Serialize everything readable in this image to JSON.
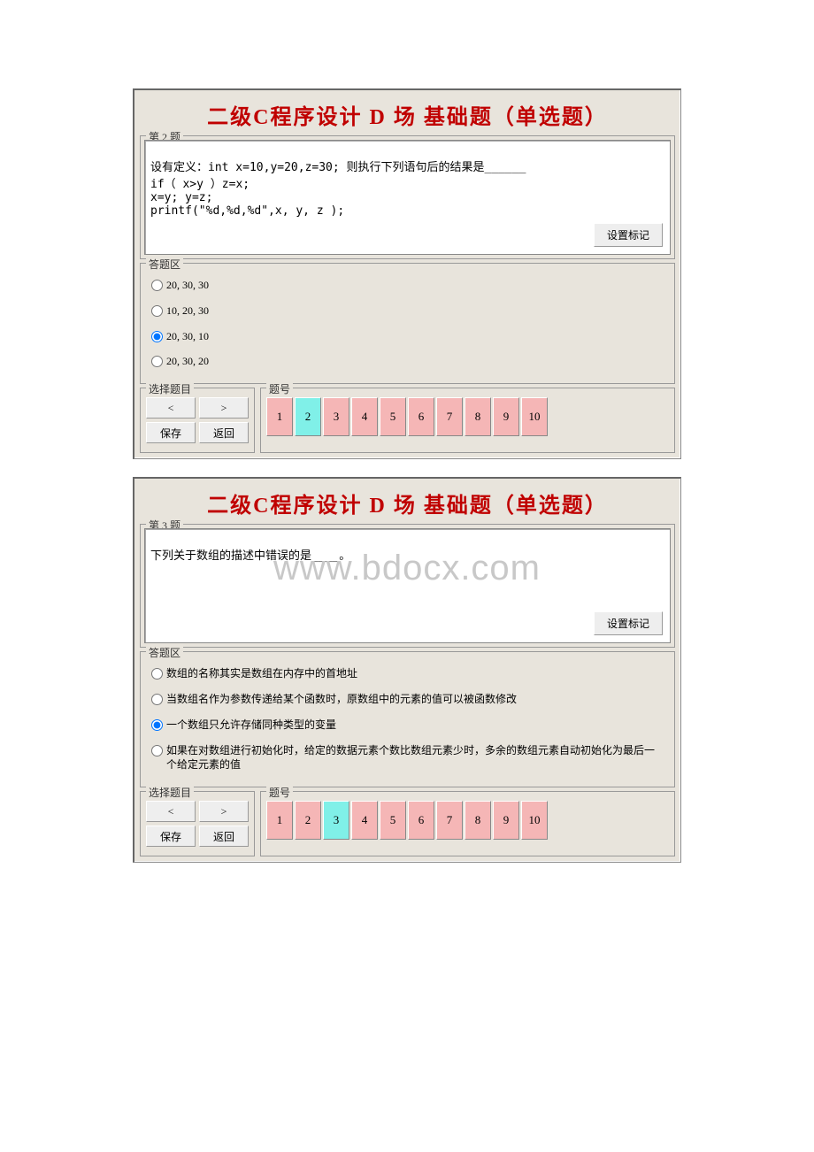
{
  "watermark": "www.bdocx.com",
  "panels": [
    {
      "title": "二级C程序设计  D  场  基础题（单选题）",
      "question_legend": "第 2 题",
      "question_text": "设有定义：int x=10,y=20,z=30; 则执行下列语句后的结果是______\nif（ x>y ）z=x;\nx=y; y=z;\nprintf(\"%d,%d,%d\",x, y, z );",
      "mark_label": "设置标记",
      "answer_legend": "答题区",
      "options": [
        {
          "label": "20, 30, 30",
          "checked": false
        },
        {
          "label": "10, 20, 30",
          "checked": false
        },
        {
          "label": "20, 30, 10",
          "checked": true
        },
        {
          "label": "20, 30, 20",
          "checked": false
        }
      ],
      "select_legend": "选择题目",
      "num_legend": "题号",
      "prev": "<",
      "next": ">",
      "save": "保存",
      "back": "返回",
      "numbers": [
        {
          "n": "1",
          "cls": "num-pink"
        },
        {
          "n": "2",
          "cls": "num-cyan"
        },
        {
          "n": "3",
          "cls": "num-pink"
        },
        {
          "n": "4",
          "cls": "num-pink"
        },
        {
          "n": "5",
          "cls": "num-pink"
        },
        {
          "n": "6",
          "cls": "num-pink"
        },
        {
          "n": "7",
          "cls": "num-pink"
        },
        {
          "n": "8",
          "cls": "num-pink"
        },
        {
          "n": "9",
          "cls": "num-pink"
        },
        {
          "n": "10",
          "cls": "num-pink"
        }
      ]
    },
    {
      "title": "二级C程序设计  D  场  基础题（单选题）",
      "question_legend": "第 3 题",
      "question_text": "下列关于数组的描述中错误的是____。",
      "mark_label": "设置标记",
      "answer_legend": "答题区",
      "options": [
        {
          "label": "数组的名称其实是数组在内存中的首地址",
          "checked": false
        },
        {
          "label": "当数组名作为参数传递给某个函数时，原数组中的元素的值可以被函数修改",
          "checked": false
        },
        {
          "label": "一个数组只允许存储同种类型的变量",
          "checked": true
        },
        {
          "label": "如果在对数组进行初始化时，给定的数据元素个数比数组元素少时，多余的数组元素自动初始化为最后一个给定元素的值",
          "checked": false
        }
      ],
      "select_legend": "选择题目",
      "num_legend": "题号",
      "prev": "<",
      "next": ">",
      "save": "保存",
      "back": "返回",
      "numbers": [
        {
          "n": "1",
          "cls": "num-pink"
        },
        {
          "n": "2",
          "cls": "num-pink"
        },
        {
          "n": "3",
          "cls": "num-cyan"
        },
        {
          "n": "4",
          "cls": "num-pink"
        },
        {
          "n": "5",
          "cls": "num-pink"
        },
        {
          "n": "6",
          "cls": "num-pink"
        },
        {
          "n": "7",
          "cls": "num-pink"
        },
        {
          "n": "8",
          "cls": "num-pink"
        },
        {
          "n": "9",
          "cls": "num-pink"
        },
        {
          "n": "10",
          "cls": "num-pink"
        }
      ]
    }
  ]
}
